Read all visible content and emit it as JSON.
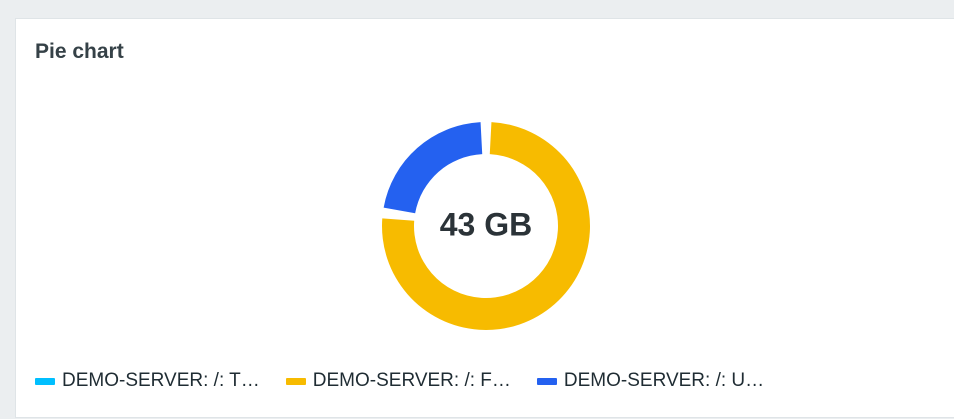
{
  "widget": {
    "title": "Pie chart"
  },
  "chart_data": {
    "type": "pie",
    "style": "doughnut",
    "title": "Pie chart",
    "center_label": "43 GB",
    "slices": [
      {
        "label": "DEMO-SERVER: /: T…",
        "value": 0,
        "color": "#00bfff"
      },
      {
        "label": "DEMO-SERVER: /: F…",
        "value": 77,
        "color": "#f7bb00"
      },
      {
        "label": "DEMO-SERVER: /: U…",
        "value": 23,
        "color": "#2461f0"
      }
    ],
    "legend_position": "bottom-left"
  }
}
